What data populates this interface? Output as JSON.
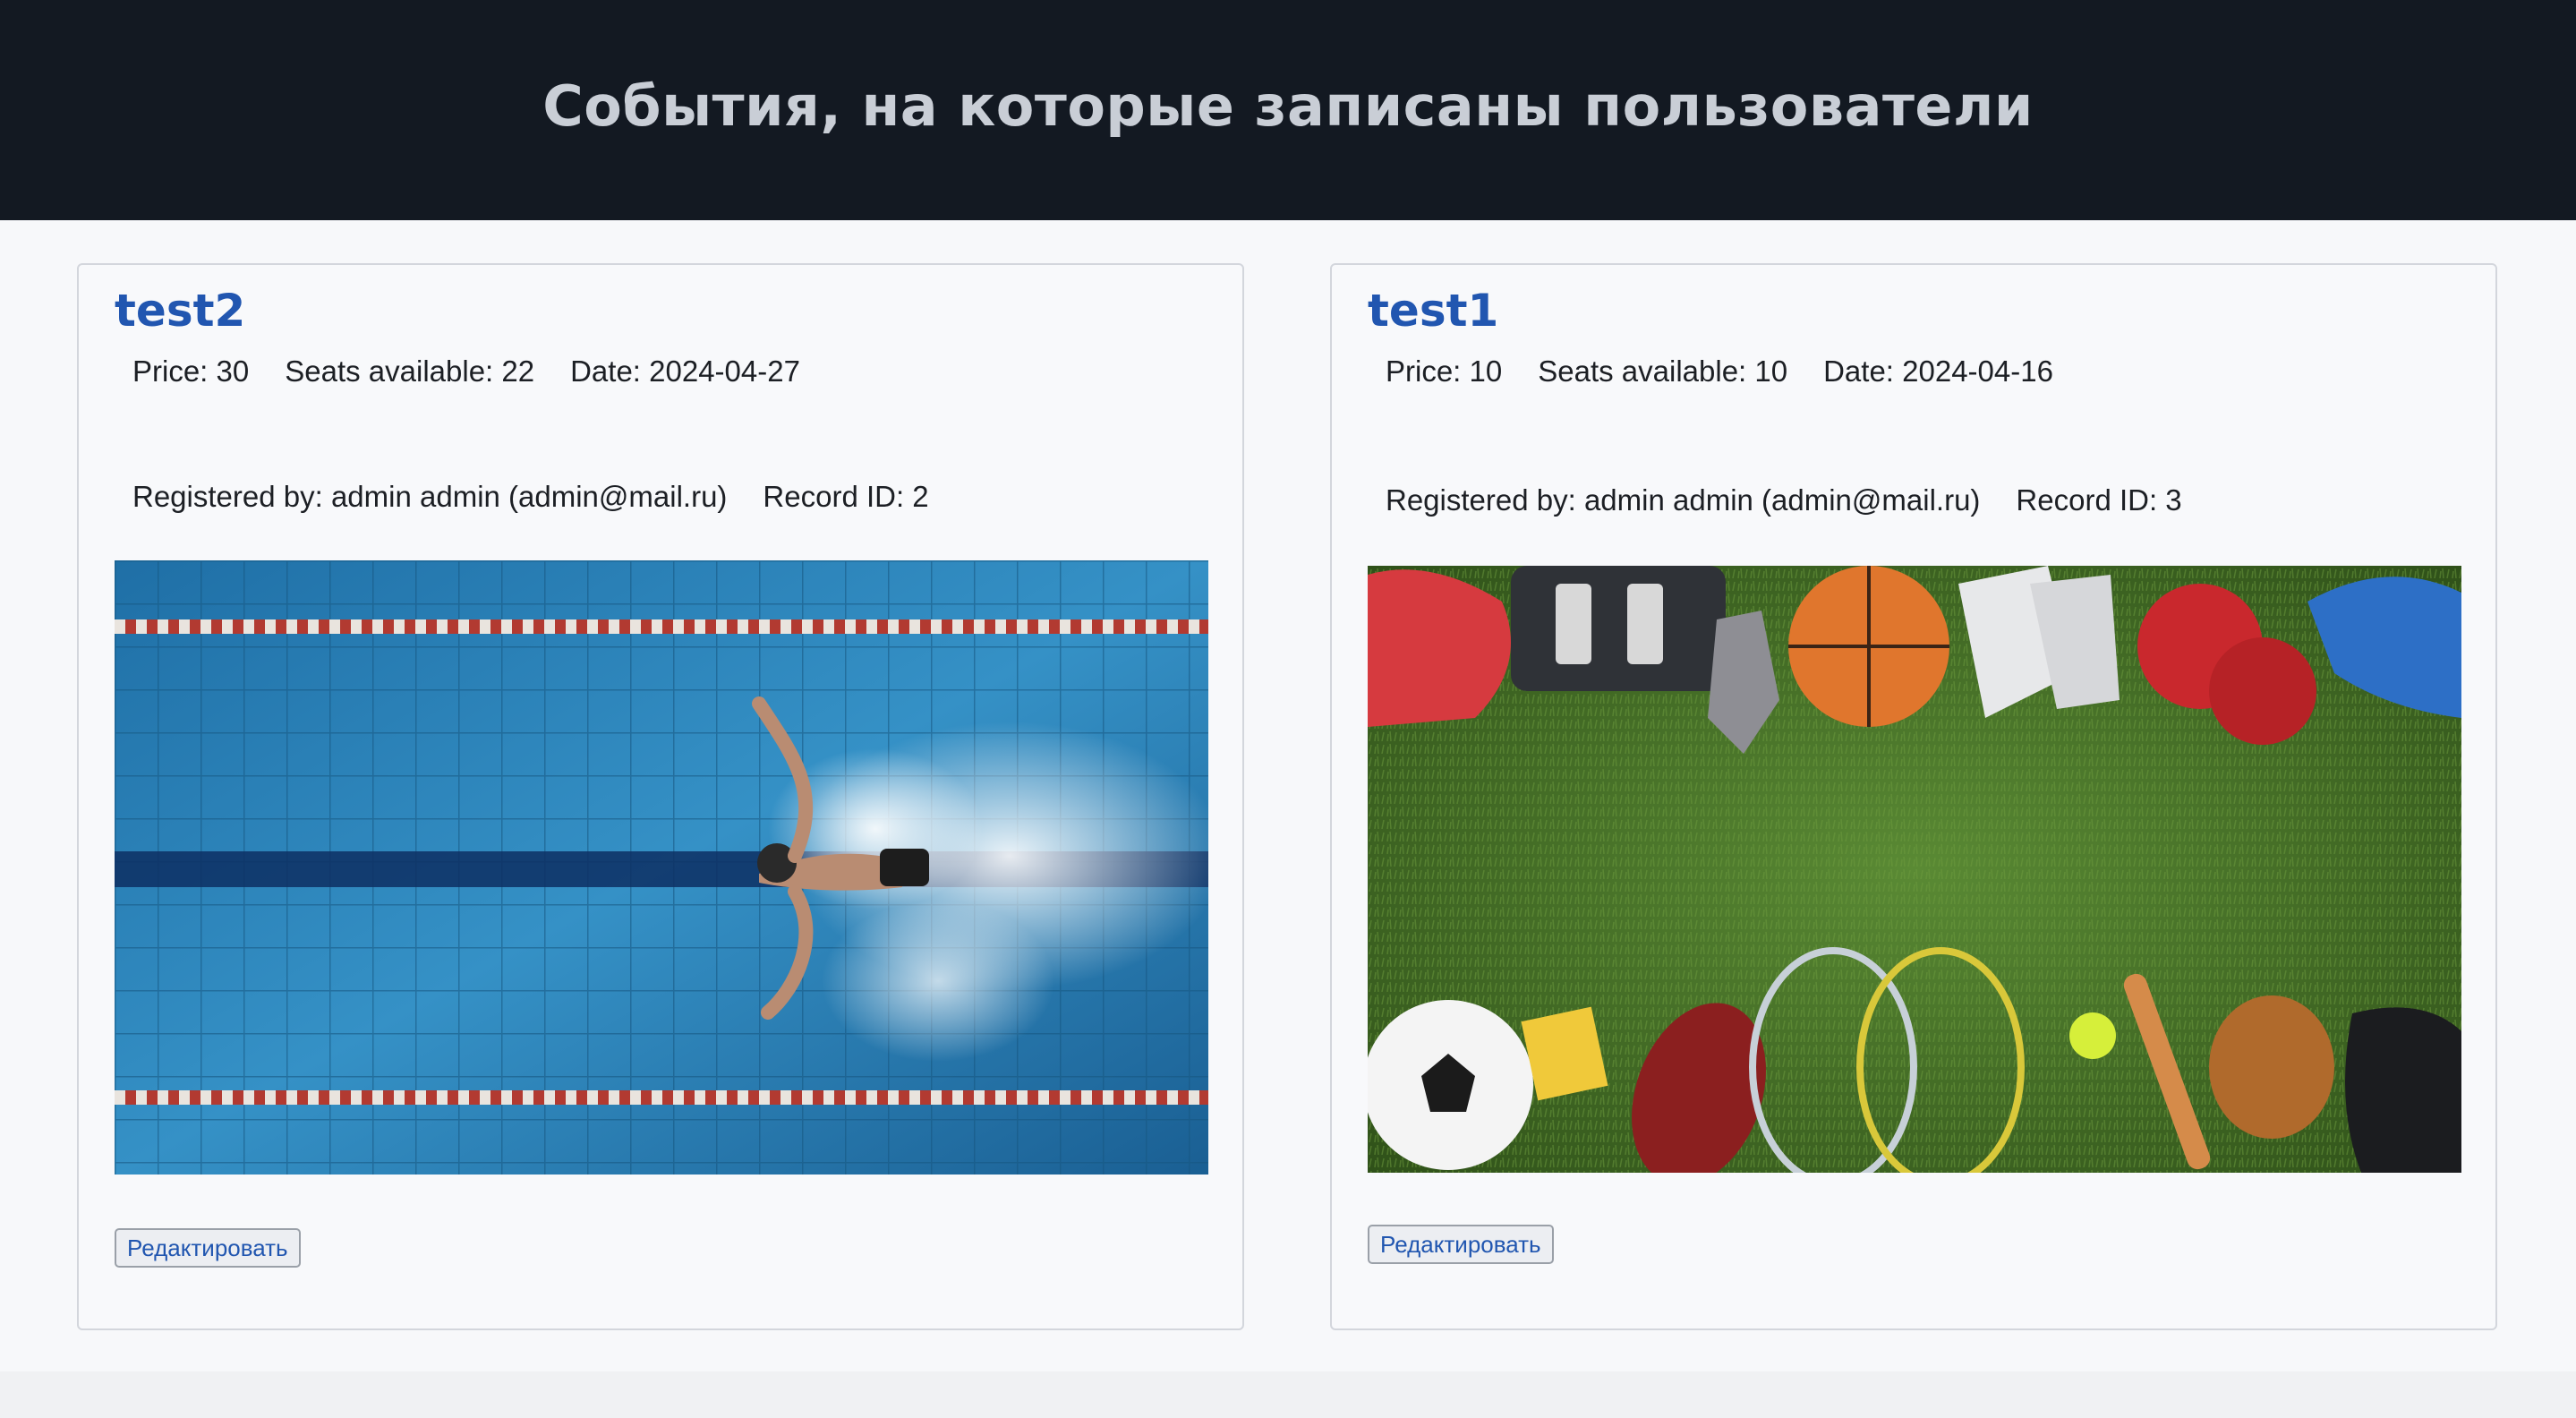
{
  "header": {
    "title": "События, на которые записаны пользователи"
  },
  "events": [
    {
      "name": "test2",
      "price_label": "Price: 30",
      "seats_label": "Seats available: 22",
      "date_label": "Date: 2024-04-27",
      "registered_label": "Registered by: admin admin (admin@mail.ru)",
      "record_label": "Record ID: 2",
      "image": "swimmer-pool-photo",
      "edit_label": "Редактировать"
    },
    {
      "name": "test1",
      "price_label": "Price: 10",
      "seats_label": "Seats available: 10",
      "date_label": "Date: 2024-04-16",
      "registered_label": "Registered by: admin admin (admin@mail.ru)",
      "record_label": "Record ID: 3",
      "image": "sports-equipment-on-grass-photo",
      "edit_label": "Редактировать"
    }
  ],
  "colors": {
    "header_bg": "#131922",
    "title_link": "#2156b0",
    "pool_water": "#2a7fb5",
    "grass": "#3f6a26"
  }
}
